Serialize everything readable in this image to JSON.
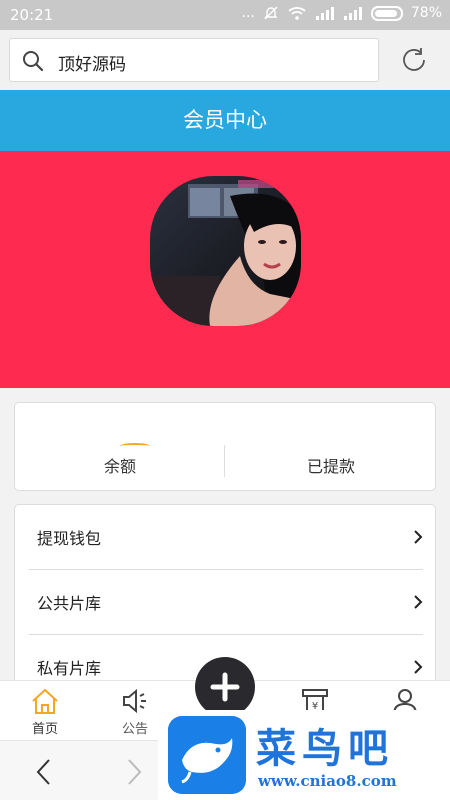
{
  "status_bar": {
    "time": "20:21",
    "dots": "...",
    "battery_percent": "78%"
  },
  "browser": {
    "search_text": "顶好源码"
  },
  "header": {
    "title": "会员中心"
  },
  "colors": {
    "header_bg": "#29a8e0",
    "banner_bg": "#ff2a4f",
    "fab_bg": "#2a2a2e",
    "accent_loader": "#f5a623"
  },
  "balance": {
    "left_label": "余额",
    "right_label": "已提款"
  },
  "menu": {
    "items": [
      {
        "label": "提现钱包",
        "icon": "chevron-right-icon"
      },
      {
        "label": "公共片库",
        "icon": "chevron-right-icon"
      },
      {
        "label": "私有片库",
        "icon": "chevron-right-icon"
      }
    ]
  },
  "tabs": [
    {
      "label": "首页",
      "icon": "home-icon"
    },
    {
      "label": "公告",
      "icon": "speaker-icon"
    },
    {
      "label": "",
      "icon": "plus-icon"
    },
    {
      "label": "",
      "icon": "yen-receipt-icon"
    },
    {
      "label": "",
      "icon": "user-icon"
    }
  ],
  "watermark": {
    "title": "菜鸟吧",
    "url": "www.cniao8.com"
  }
}
